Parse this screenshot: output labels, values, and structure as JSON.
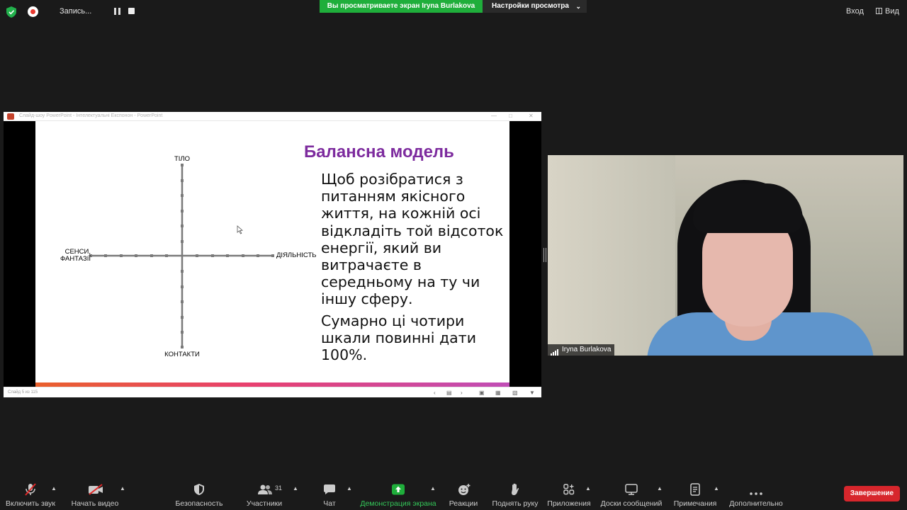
{
  "top_bar": {
    "recording_label": "Запись...",
    "viewing_banner": "Вы просматриваете экран Iryna Burlakova",
    "view_settings": "Настройки просмотра",
    "enter_button": "Вход",
    "view_button": "Вид"
  },
  "shared_screen": {
    "window_title": "Слайд-шоу PowerPoint  -  Інтелектуальні Експонон  -  PowerPoint",
    "status_text": "Слайд 5 из 115",
    "slide": {
      "title": "Балансна модель",
      "paragraph1": "Щоб розібратися з питанням якісного життя, на кожній осі відкладіть той відсоток енергії, який ви витрачаєте в середньому на ту чи іншу сферу.",
      "paragraph2": "Сумарно ці чотири шкали повинні дати 100%.",
      "axis_top": "ТІЛО",
      "axis_right": "ДІЯЛЬНІСТЬ",
      "axis_bottom": "КОНТАКТИ",
      "axis_left_line1": "СЕНСИ,",
      "axis_left_line2": "ФАНТАЗІЇ"
    }
  },
  "video": {
    "participant_name": "Iryna Burlakova"
  },
  "toolbar": {
    "unmute": "Включить звук",
    "start_video": "Начать видео",
    "security": "Безопасность",
    "participants": "Участники",
    "participants_count": "31",
    "chat": "Чат",
    "share_screen": "Демонстрация экрана",
    "reactions": "Реакции",
    "raise_hand": "Поднять руку",
    "apps": "Приложения",
    "whiteboards": "Доски сообщений",
    "notes": "Примечания",
    "more": "Дополнительно",
    "end": "Завершение"
  },
  "colors": {
    "accent_green": "#1fae3b",
    "end_red": "#d7262c",
    "slide_title_purple": "#7d2b9e"
  }
}
